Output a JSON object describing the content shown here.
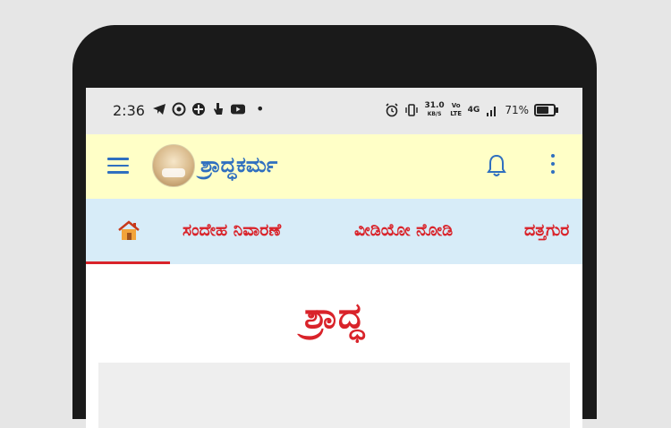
{
  "status_bar": {
    "time": "2:36",
    "left_icons": [
      "telegram-icon",
      "whatsapp-icon",
      "app-icon",
      "hand-icon",
      "youtube-icon"
    ],
    "dot": "•",
    "speed_value": "31.0",
    "speed_unit": "KB/S",
    "volte": "Vo LTE",
    "network": "4G",
    "battery": "71%"
  },
  "app_bar": {
    "title": "ಶ್ರಾದ್ಧಕರ್ಮ"
  },
  "tabs": [
    {
      "label": "ಸಂದೇಹ ನಿವಾರಣೆ"
    },
    {
      "label": "ವೀಡಿಯೋ ನೋಡಿ"
    },
    {
      "label": "ದತ್ತಗುರ"
    }
  ],
  "content": {
    "title": "ಶ್ರಾದ್ಧ"
  },
  "colors": {
    "accent_blue": "#2f6fbf",
    "accent_red": "#d9232a",
    "appbar_bg": "#ffffc7",
    "tabbar_bg": "#d7ecf8"
  }
}
